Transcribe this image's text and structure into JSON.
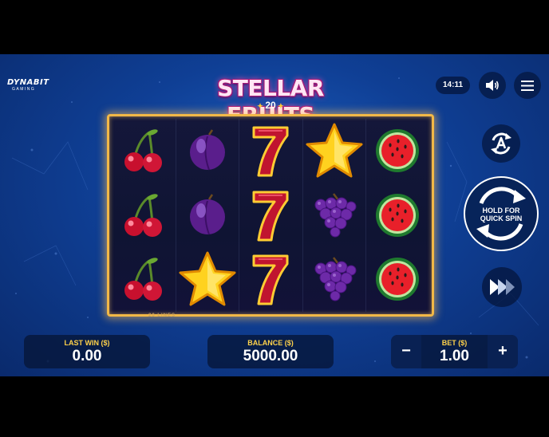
{
  "provider": {
    "name": "DYNABIT",
    "sub": "GAMING"
  },
  "logo": {
    "title": "STELLAR FRUITS",
    "sub": "20"
  },
  "clock": "14:11",
  "icons": {
    "sound": "speaker-icon",
    "menu": "hamburger-menu-icon",
    "autoplay": "autoplay-icon",
    "turbo": "turbo-fast-forward-icon"
  },
  "reels": [
    [
      "cherry",
      "cherry",
      "cherry"
    ],
    [
      "plum",
      "plum",
      "star"
    ],
    [
      "seven",
      "seven",
      "seven"
    ],
    [
      "star",
      "grapes",
      "grapes"
    ],
    [
      "watermelon",
      "watermelon",
      "watermelon"
    ]
  ],
  "lines_label": "20 LINES",
  "spin": {
    "label_line1": "HOLD FOR",
    "label_line2": "QUICK SPIN"
  },
  "last_win": {
    "label": "LAST WIN ($)",
    "value": "0.00"
  },
  "balance": {
    "label": "BALANCE ($)",
    "value": "5000.00"
  },
  "bet": {
    "label": "BET ($)",
    "value": "1.00",
    "minus": "−",
    "plus": "+"
  },
  "colors": {
    "background": "#1d5fc0",
    "frame": "#f2b847",
    "label": "#ffd24a"
  }
}
